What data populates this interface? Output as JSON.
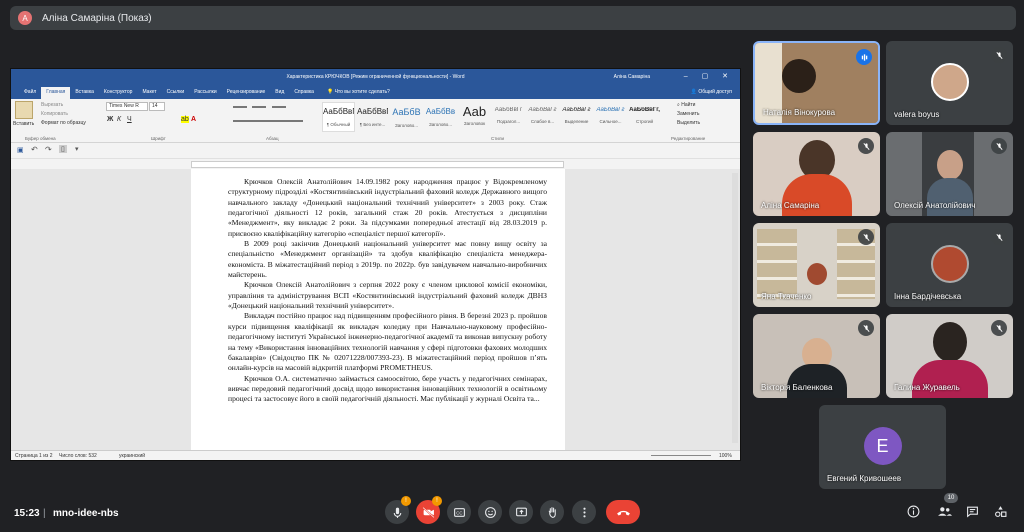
{
  "presenter_bar": {
    "avatar_letter": "A",
    "label": "Аліна Самаріна (Показ)"
  },
  "word": {
    "title": "Характеристика КРЮЧКОВ [Режим ограниченной функциональности] - Word",
    "user": "Аліна Самаріна",
    "tabs": [
      "Файл",
      "Главная",
      "Вставка",
      "Конструктор",
      "Макет",
      "Ссылки",
      "Рассылки",
      "Рецензирование",
      "Вид",
      "Справка"
    ],
    "active_tab": "Главная",
    "tellme": "Что вы хотите сделать?",
    "share": "Общий доступ",
    "clipboard": {
      "paste": "Вставить",
      "cut": "Вырезать",
      "copy": "Копировать",
      "format": "Формат по образцу",
      "group": "Буфер обмена"
    },
    "font": {
      "name": "Times New R",
      "size": "14",
      "group": "Шрифт"
    },
    "paragraph_group": "Абзац",
    "styles_group": "Стили",
    "styles": [
      {
        "sample": "АаБбВвГг,",
        "name": "¶ Обычный"
      },
      {
        "sample": "АаБбВвГг,",
        "name": "¶ Без инте..."
      },
      {
        "sample": "АаБбВ",
        "name": "Заголово..."
      },
      {
        "sample": "АаБбВв",
        "name": "Заголово..."
      },
      {
        "sample": "Aab",
        "name": "Заголовок"
      },
      {
        "sample": "АаБбВвГг",
        "name": "Подзагол..."
      },
      {
        "sample": "АаБбВвГг",
        "name": "Слабое в..."
      },
      {
        "sample": "АаБбВвГг",
        "name": "Выделение"
      },
      {
        "sample": "АаБбВвГг",
        "name": "Сильное..."
      },
      {
        "sample": "АаБбВвГг,",
        "name": "Строгий"
      }
    ],
    "editing": {
      "find": "Найти",
      "replace": "Заменить",
      "select": "Выделить",
      "group": "Редактирование"
    },
    "document": {
      "paragraphs": [
        "Крючков Олексій Анатолійович 14.09.1982 року народження працює у Відокремленому структурному підрозділі «Костянтинівський індустріальний фаховий коледж Державного вищого навчального закладу «Донецький національний технічний університет» з 2003 року. Стаж педагогічної діяльності 12 років, загальний стаж 20 років. Атестується з дисципліни «Менеджмент», яку викладає 2 роки. За підсумками попередньої атестації від 28.03.2019 р. присвоєно кваліфікаційну категорію «спеціаліст першої категорії».",
        "В 2009 році закінчив Донецький національний університет має повну вищу освіту за спеціальністю «Менеджмент організацій» та здобув кваліфікацію спеціаліста менеджера-економіста. В міжатестаційний період з 2019р. по 2022р. був завідувачем навчально-виробничих майстерень.",
        "Крючков Олексій Анатолійович з серпня 2022 року є членом циклової комісії економіки, управління та адміністрування ВСП «Костянтинівський індустріальний фаховий коледж ДВНЗ «Донецький національний технічний університет».",
        "Викладач постійно працює над підвищенням професійного рівня. В березні 2023 р. пройшов курси підвищення кваліфікації як викладач коледжу при Навчально-науковому професійно-педагогічному інституті Української інженерно-педагогічної академії та виконав випускну роботу на тему «Використання інноваційних технологій навчання у сфері підготовки фахових молодших бакалаврів» (Свідоцтво ПК № 02071228/007393-23). В міжатестаційний період пройшов п’ять онлайн-курсів на масовій відкритій платформі PROMETHEUS.",
        "Крючков О.А. систематично займається самоосвітою, бере участь у педагогічних семінарах, вивчає передовий педагогічний досвід щодо використання інноваційних технологій в освітньому процесі та застосовує його в своїй педагогічній діяльності. Має публікації у журналі Освіта та..."
      ]
    },
    "status": {
      "page": "Страница 1 из 2",
      "words": "Число слов: 532",
      "lang": "украинский",
      "zoom": "100%"
    }
  },
  "participants": [
    {
      "name": "Наталія Вінокурова",
      "muted": false,
      "active": true
    },
    {
      "name": "valera boyus",
      "muted": true
    },
    {
      "name": "Аліна Самаріна",
      "muted": true
    },
    {
      "name": "Олексій Анатолійович",
      "muted": true
    },
    {
      "name": "Яна Ткаченко",
      "muted": true
    },
    {
      "name": "Інна Бардічевська",
      "muted": true
    },
    {
      "name": "Вікторія Баленкова",
      "muted": true
    },
    {
      "name": "Галина Журавель",
      "muted": true
    },
    {
      "name": "Евгений Кривошеев",
      "initial": "E"
    }
  ],
  "bottom_bar": {
    "time": "15:23",
    "separator": "|",
    "meeting_code": "mno-idee-nbs",
    "mic_badge": "!",
    "cam_badge": "!",
    "participant_count": "10"
  },
  "colors": {
    "bg": "#202124",
    "word_blue": "#2b579a",
    "end_call": "#ea4335",
    "badge": "#f29900",
    "avatar_e": "#7e57c2"
  }
}
